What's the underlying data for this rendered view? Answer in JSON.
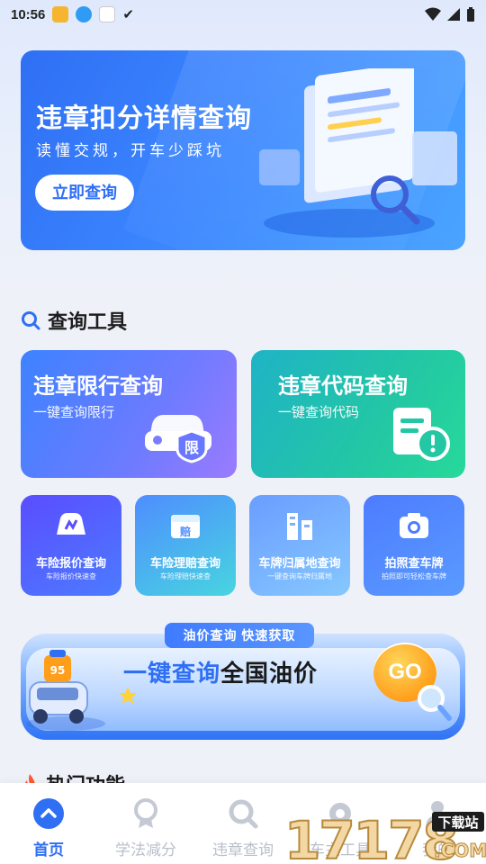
{
  "status_bar": {
    "time": "10:56"
  },
  "banner": {
    "title": "违章扣分详情查询",
    "subtitle": "读懂交规，开车少踩坑",
    "button_label": "立即查询"
  },
  "tools_section": {
    "title": "查询工具"
  },
  "big_cards": [
    {
      "title": "违章限行查询",
      "subtitle": "一键查询限行",
      "badge": "限"
    },
    {
      "title": "违章代码查询",
      "subtitle": "一键查询代码"
    }
  ],
  "small_cards": [
    {
      "title": "车险报价查询",
      "subtitle": "车险报价快速查"
    },
    {
      "title": "车险理赔查询",
      "subtitle": "车险理赔快速查",
      "icon_text": "赔"
    },
    {
      "title": "车牌归属地查询",
      "subtitle": "一键查询车牌归属地"
    },
    {
      "title": "拍照查车牌",
      "subtitle": "拍照即可轻松查车牌"
    }
  ],
  "oil_banner": {
    "tag": "油价查询  快速获取",
    "title_highlight": "一键查询",
    "title_rest": "全国油价",
    "go_label": "GO"
  },
  "hot_section": {
    "title": "热门功能"
  },
  "bottom_nav": [
    {
      "label": "首页",
      "active": true
    },
    {
      "label": "学法减分",
      "active": false
    },
    {
      "label": "违章查询",
      "active": false
    },
    {
      "label": "车主工具",
      "active": false
    },
    {
      "label": "我的",
      "active": false
    }
  ],
  "watermark": {
    "text": "17178",
    "sub": "下载站",
    "domain": ".COM"
  },
  "colors": {
    "primary": "#2f6ff4",
    "teal": "#23c7a4",
    "orange": "#ff9e1a",
    "inactive": "#b9bfca"
  }
}
